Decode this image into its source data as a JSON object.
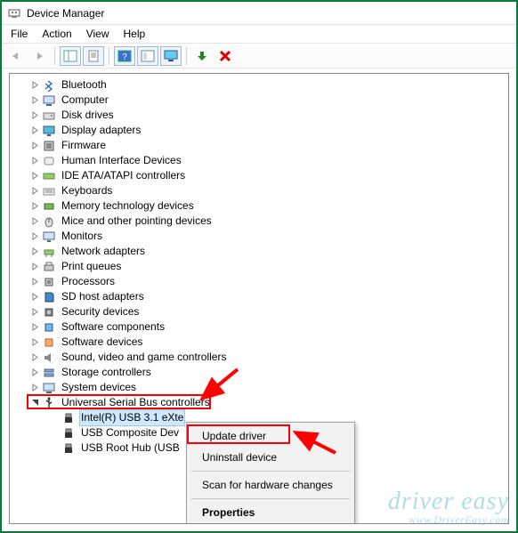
{
  "window": {
    "title": "Device Manager"
  },
  "menu": {
    "items": [
      "File",
      "Action",
      "View",
      "Help"
    ]
  },
  "toolbar": {
    "buttons": [
      {
        "name": "back-icon",
        "glyph": "arrow-left",
        "disabled": true
      },
      {
        "name": "forward-icon",
        "glyph": "arrow-right",
        "disabled": true
      },
      {
        "sep": true
      },
      {
        "name": "show-hidden-icon",
        "glyph": "panel",
        "framed": true
      },
      {
        "name": "properties-icon",
        "glyph": "sheet",
        "framed": true
      },
      {
        "sep": true
      },
      {
        "name": "help-icon",
        "glyph": "help",
        "framed": true
      },
      {
        "name": "scan-icon",
        "glyph": "panel2",
        "framed": true
      },
      {
        "name": "monitor-icon",
        "glyph": "monitor",
        "framed": true
      },
      {
        "sep": true
      },
      {
        "name": "add-legacy-icon",
        "glyph": "green-arrow"
      },
      {
        "name": "uninstall-icon",
        "glyph": "red-x"
      }
    ]
  },
  "tree": {
    "categories": [
      {
        "label": "Bluetooth",
        "icon": "bluetooth"
      },
      {
        "label": "Computer",
        "icon": "computer"
      },
      {
        "label": "Disk drives",
        "icon": "disk"
      },
      {
        "label": "Display adapters",
        "icon": "display"
      },
      {
        "label": "Firmware",
        "icon": "firmware"
      },
      {
        "label": "Human Interface Devices",
        "icon": "hid"
      },
      {
        "label": "IDE ATA/ATAPI controllers",
        "icon": "ide"
      },
      {
        "label": "Keyboards",
        "icon": "keyboard"
      },
      {
        "label": "Memory technology devices",
        "icon": "memory"
      },
      {
        "label": "Mice and other pointing devices",
        "icon": "mouse"
      },
      {
        "label": "Monitors",
        "icon": "monitor"
      },
      {
        "label": "Network adapters",
        "icon": "network"
      },
      {
        "label": "Print queues",
        "icon": "printer"
      },
      {
        "label": "Processors",
        "icon": "cpu"
      },
      {
        "label": "SD host adapters",
        "icon": "sd"
      },
      {
        "label": "Security devices",
        "icon": "security"
      },
      {
        "label": "Software components",
        "icon": "swcomp"
      },
      {
        "label": "Software devices",
        "icon": "swdev"
      },
      {
        "label": "Sound, video and game controllers",
        "icon": "sound"
      },
      {
        "label": "Storage controllers",
        "icon": "storage"
      },
      {
        "label": "System devices",
        "icon": "system"
      }
    ],
    "usb_category": {
      "label": "Universal Serial Bus controllers",
      "icon": "usb"
    },
    "usb_children": [
      {
        "label": "Intel(R) USB 3.1 eXte",
        "icon": "usbdev",
        "selected": true,
        "truncated": true
      },
      {
        "label": "USB Composite Dev",
        "icon": "usbdev"
      },
      {
        "label": "USB Root Hub (USB",
        "icon": "usbdev"
      }
    ]
  },
  "context_menu": {
    "items": [
      {
        "label": "Update driver",
        "highlighted": true
      },
      {
        "label": "Uninstall device"
      },
      {
        "sep": true
      },
      {
        "label": "Scan for hardware changes"
      },
      {
        "sep": true
      },
      {
        "label": "Properties",
        "bold": true
      }
    ]
  },
  "watermark": {
    "line1": "driver easy",
    "line2": "www.DriverEasy.com"
  }
}
